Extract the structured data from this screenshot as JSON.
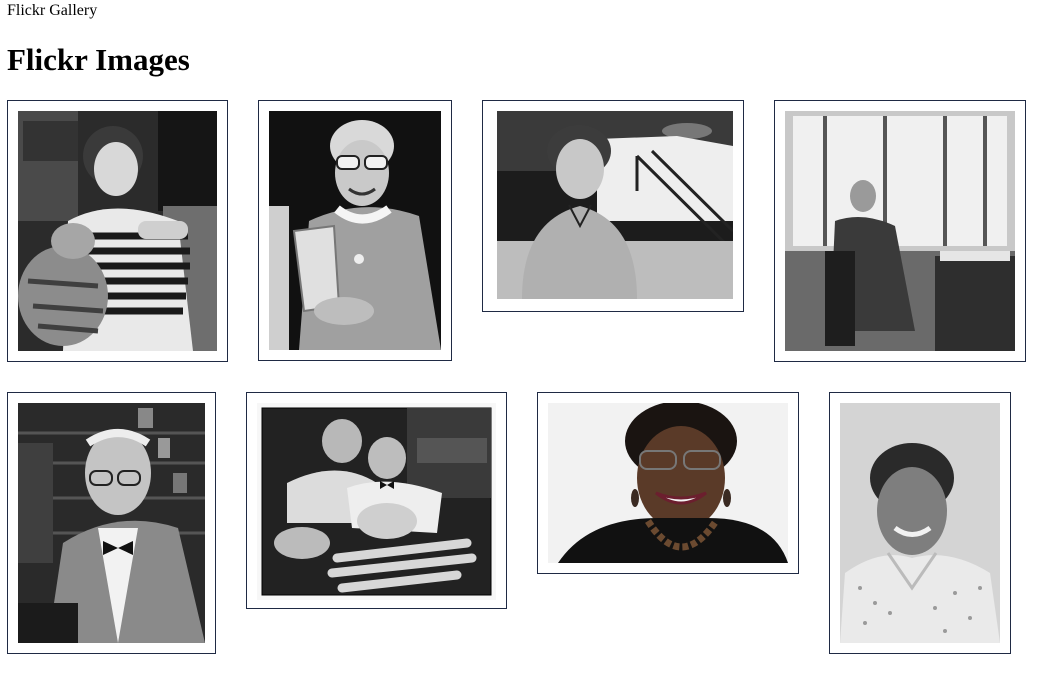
{
  "window": {
    "title": "Flickr Gallery"
  },
  "page": {
    "heading": "Flickr Images"
  },
  "gallery": {
    "frame_border_color": "#1f2a44",
    "photos": [
      {
        "id": "photo-1",
        "subject": "woman holding a tiger cub",
        "tone": "monochrome"
      },
      {
        "id": "photo-2",
        "subject": "smiling woman with glasses holding a glass vessel",
        "tone": "monochrome"
      },
      {
        "id": "photo-3",
        "subject": "woman in front of a building with a staircase",
        "tone": "monochrome"
      },
      {
        "id": "photo-4",
        "subject": "woman seated by a large window",
        "tone": "monochrome"
      },
      {
        "id": "photo-5",
        "subject": "man with glasses and bow tie",
        "tone": "monochrome"
      },
      {
        "id": "photo-6",
        "subject": "two men examining crab specimens",
        "tone": "monochrome"
      },
      {
        "id": "photo-7",
        "subject": "smiling woman with glasses and necklace",
        "tone": "color"
      },
      {
        "id": "photo-8",
        "subject": "smiling woman in polka dot blouse",
        "tone": "monochrome"
      }
    ]
  }
}
